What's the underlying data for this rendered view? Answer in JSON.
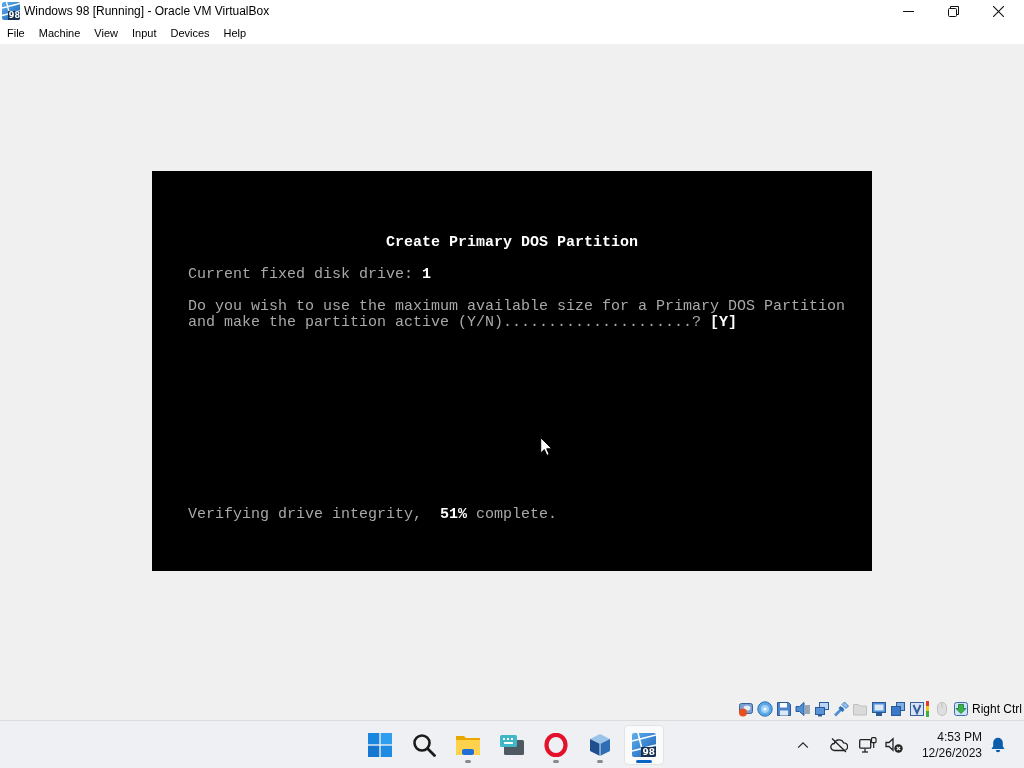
{
  "window": {
    "title": "Windows 98 [Running] - Oracle VM VirtualBox",
    "icon_badge": "98"
  },
  "menu_bar": {
    "items": [
      "File",
      "Machine",
      "View",
      "Input",
      "Devices",
      "Help"
    ]
  },
  "vm_screen": {
    "heading": "Create Primary DOS Partition",
    "drive_line": "Current fixed disk drive: **1**",
    "prompt_lines": [
      "Do you wish to use the maximum available size for a Primary DOS Partition",
      "and make the partition active (Y/N).....................? **[Y]**"
    ],
    "progress_line": "Verifying drive integrity,  **51%** complete."
  },
  "status_bar": {
    "indicators": [
      {
        "kind": "hard-disk",
        "disabled": false
      },
      {
        "kind": "optical-disc",
        "disabled": false
      },
      {
        "kind": "floppy",
        "disabled": false
      },
      {
        "kind": "audio",
        "disabled": false
      },
      {
        "kind": "network",
        "disabled": false
      },
      {
        "kind": "usb",
        "disabled": false
      },
      {
        "kind": "shared-folder",
        "disabled": true
      },
      {
        "kind": "display",
        "disabled": false
      },
      {
        "kind": "recording",
        "disabled": false
      },
      {
        "kind": "features",
        "disabled": false
      },
      {
        "kind": "mouse",
        "disabled": true
      },
      {
        "kind": "host-key",
        "disabled": false
      }
    ],
    "host_key": "Right Ctrl"
  },
  "taskbar": {
    "apps": [
      {
        "kind": "start",
        "running": false,
        "selected": false
      },
      {
        "kind": "search",
        "running": false,
        "selected": false
      },
      {
        "kind": "folder",
        "running": true,
        "selected": false
      },
      {
        "kind": "keyboard",
        "running": false,
        "selected": false
      },
      {
        "kind": "ring",
        "running": true,
        "selected": false
      },
      {
        "kind": "cube",
        "running": true,
        "selected": false
      },
      {
        "kind": "vm",
        "running": true,
        "selected": true,
        "badge": "98"
      }
    ],
    "tray": {
      "volume": {
        "muted": true
      },
      "time": "4:53 PM",
      "date": "12/26/2023"
    }
  }
}
